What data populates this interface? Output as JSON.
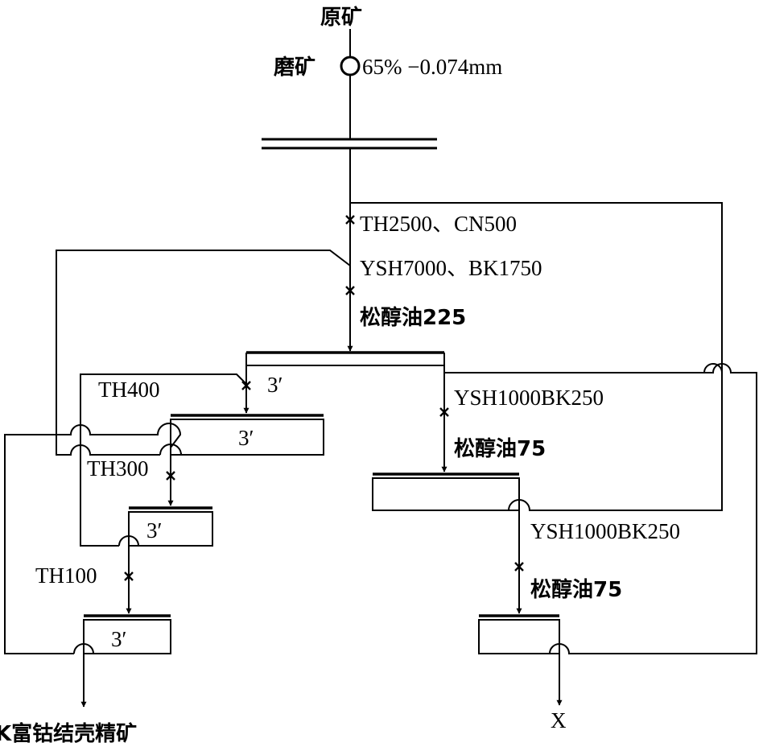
{
  "feed": {
    "label": "原矿"
  },
  "grinding": {
    "label": "磨矿",
    "fineness": "65% −0.074mm"
  },
  "rougher_reagents": {
    "line1": "TH2500、CN500",
    "line2": "YSH7000、BK1750",
    "line3": "松醇油225"
  },
  "cleaner_1": {
    "reagent": "TH400",
    "time_feed": "3′",
    "time_cell": "3′"
  },
  "cleaner_2": {
    "reagent": "TH300",
    "time_cell": "3′"
  },
  "cleaner_3": {
    "reagent": "TH100",
    "time_cell": "3′"
  },
  "scavenger_1": {
    "reagent_1": "YSH1000BK250",
    "reagent_2": "松醇油75"
  },
  "scavenger_2": {
    "reagent_1": "YSH1000BK250",
    "reagent_2": "松醇油75"
  },
  "products": {
    "concentrate": "K富钴结壳精矿",
    "tailings": "X"
  }
}
